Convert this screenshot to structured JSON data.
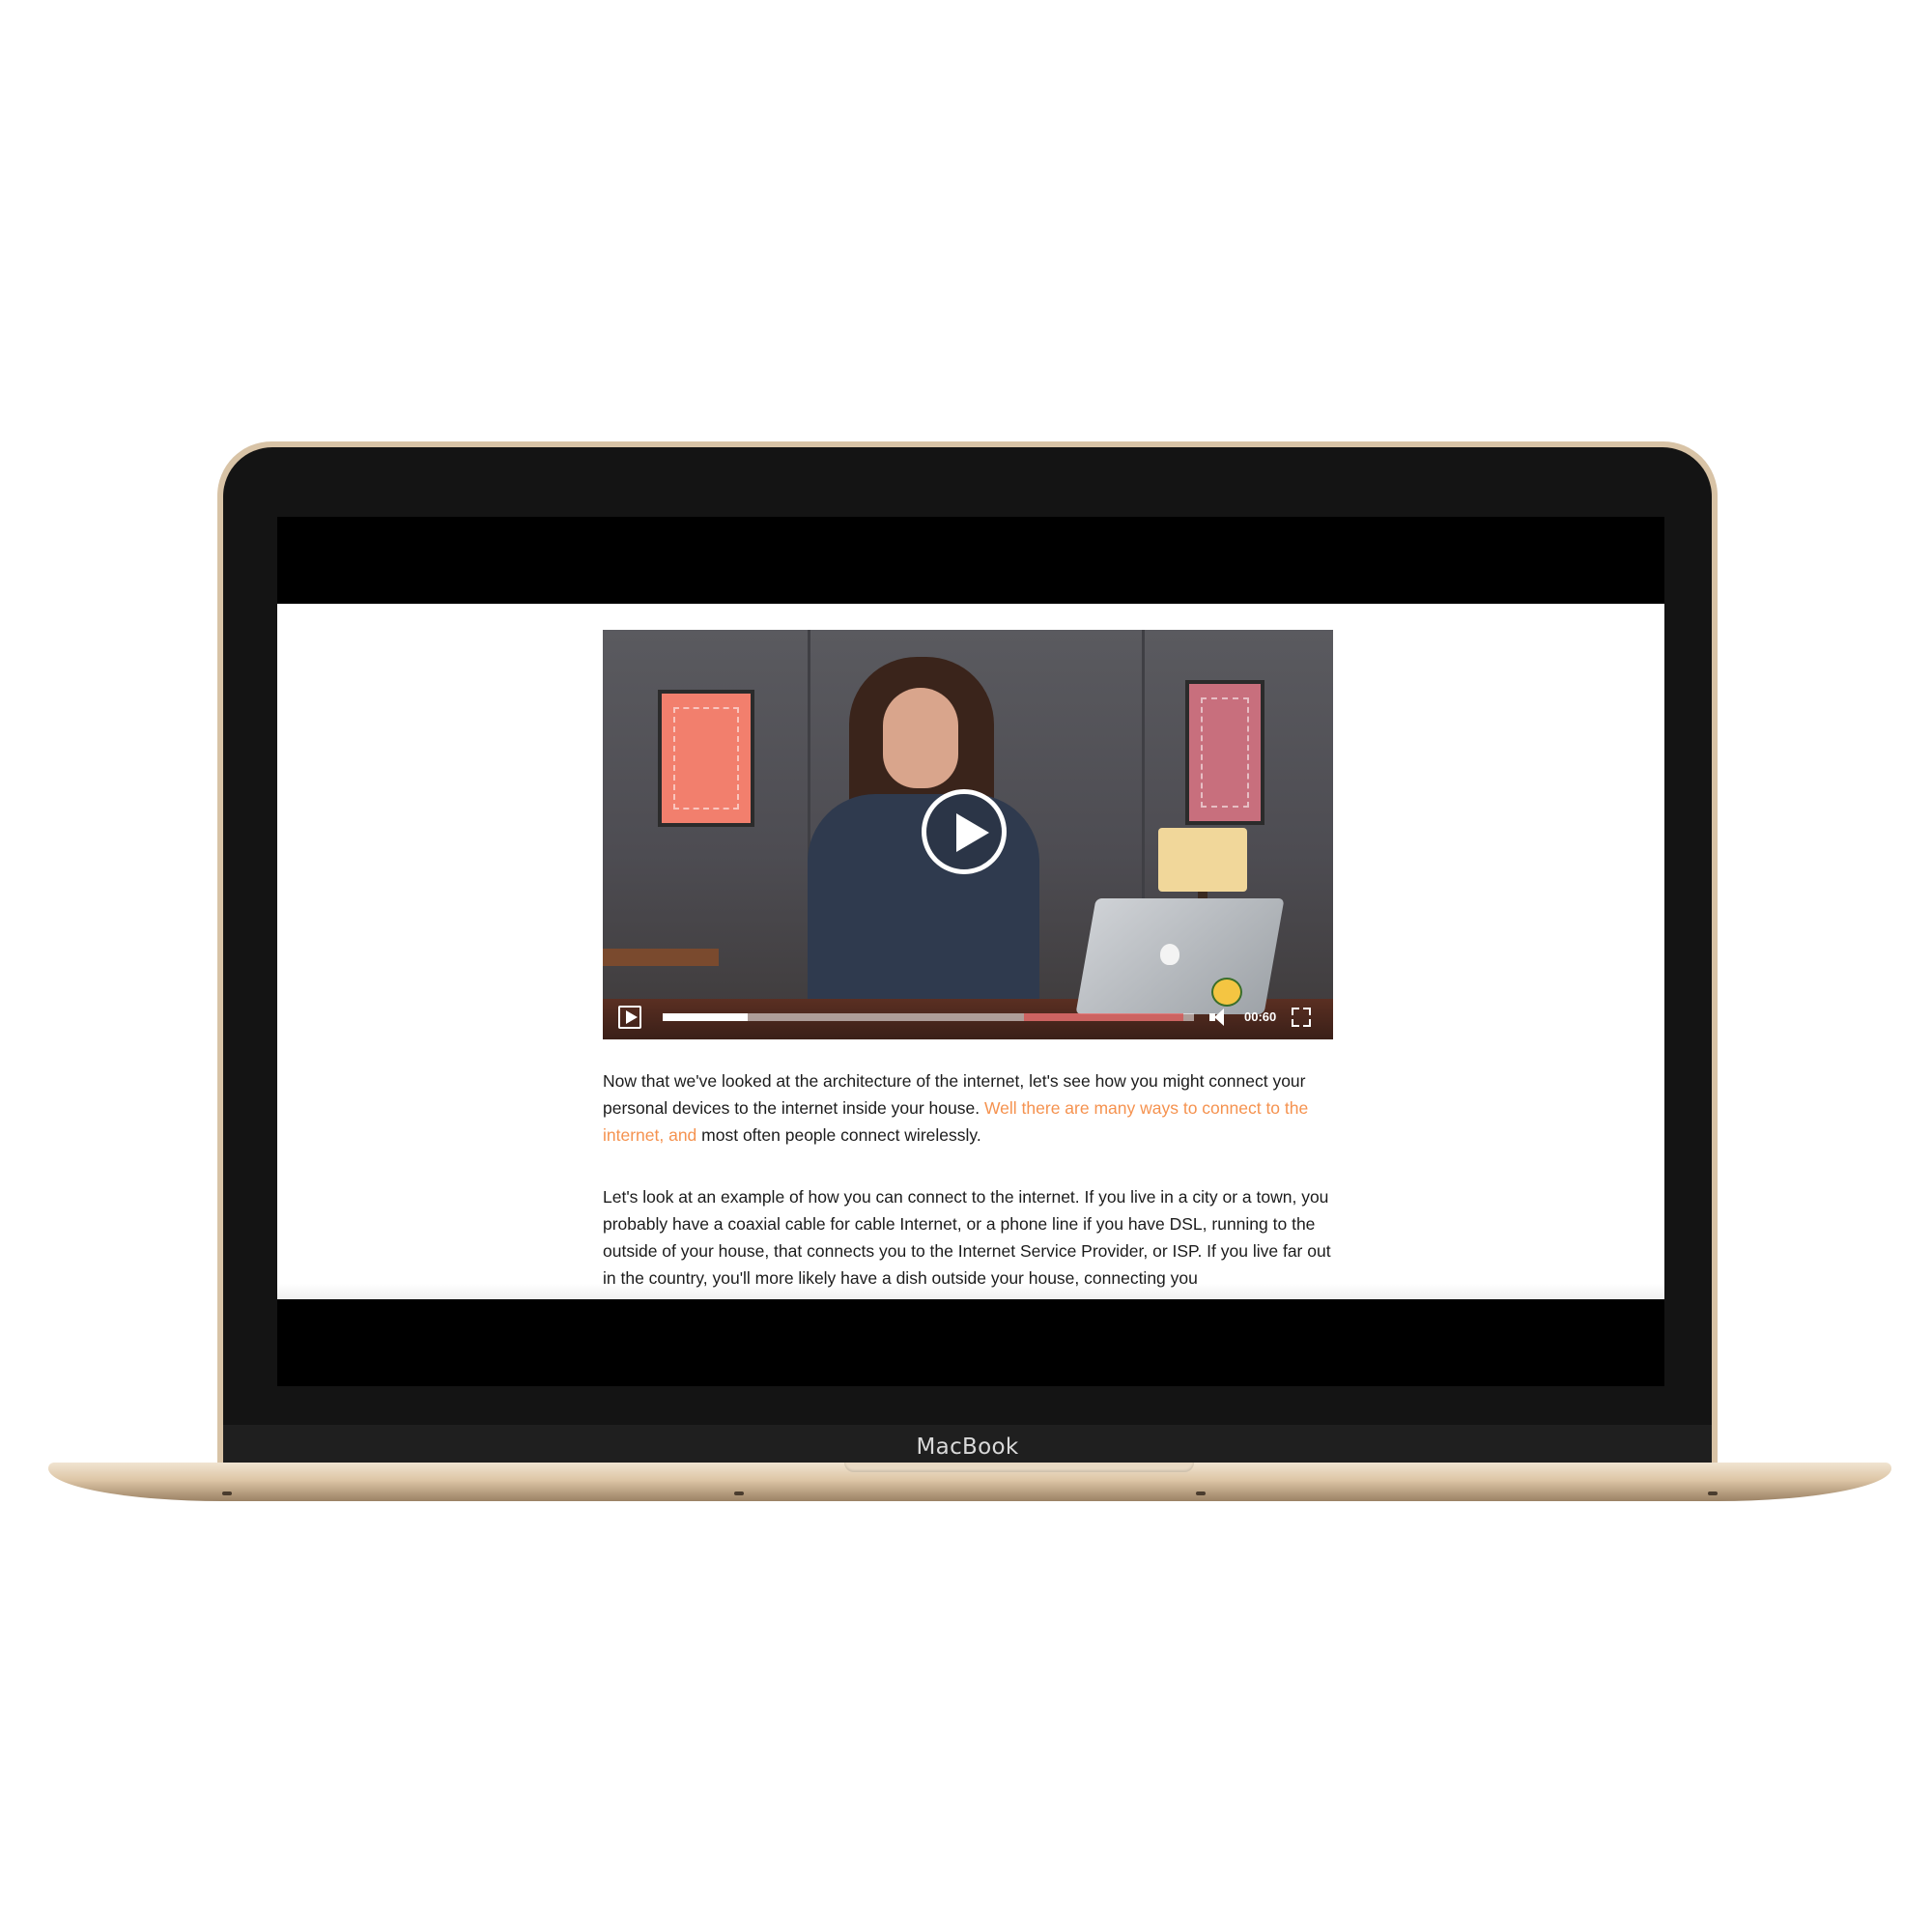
{
  "device": {
    "brand_label": "MacBook"
  },
  "video": {
    "time": "00:60",
    "progress": 0.16,
    "icons": {
      "big_play": "play-circle-icon",
      "play": "play-icon",
      "volume": "volume-icon",
      "fullscreen": "fullscreen-icon"
    }
  },
  "article": {
    "p1_text_a": "Now that we've looked at the architecture of the internet, let's see how you might connect your personal devices to the internet inside your house. ",
    "p1_highlight": "Well there are many ways to connect to the internet, and",
    "p1_text_b": " most often people connect wirelessly.",
    "p2_text": "Let's look at an example of how you can connect to the internet. If you live in a city or a town, you probably have a coaxial cable for cable Internet, or a phone line if you have DSL, running to the outside of your house, that connects you to the Internet Service Provider, or ISP. If you live far out in the country, you'll more likely have a dish outside your house, connecting you"
  },
  "colors": {
    "highlight": "#f5924f",
    "bezel": "#141414",
    "gold": "#d8c3a6"
  }
}
